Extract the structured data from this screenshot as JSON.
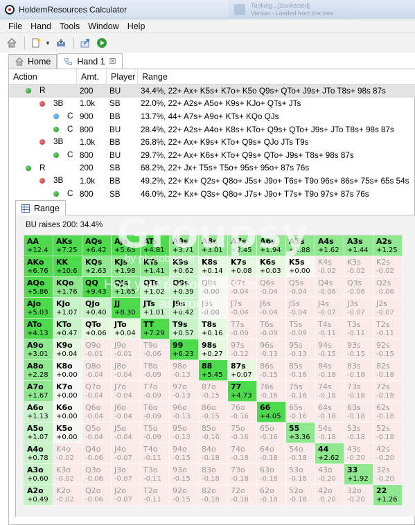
{
  "window": {
    "title": "HoldemResources Calculator"
  },
  "notification": {
    "line1": "Tanking...[Sunkissed]",
    "line2": "Versus - Loaded from the tree"
  },
  "menu": [
    "File",
    "Hand",
    "Tools",
    "Window",
    "Help"
  ],
  "toolbar": {
    "icons": [
      "home-icon",
      "new-document-icon",
      "open-icon",
      "export-icon",
      "run-icon"
    ]
  },
  "tabs": [
    {
      "label": "Home",
      "icon": "home-icon"
    },
    {
      "label": "Hand 1",
      "icon": "hand-icon",
      "closable": true
    }
  ],
  "table": {
    "headers": {
      "action": "Action",
      "amount": "Amt.",
      "player": "Player",
      "range": "Range"
    },
    "rows": [
      {
        "level": 0,
        "dot": "green",
        "action": "R",
        "amount": "200",
        "player": "BU",
        "range": "34.4%, 22+ Ax+ K5s+ K7o+ K5o Q9s+ QTo+ J9s+ JTo T8s+ 98s 87s",
        "selected": true
      },
      {
        "level": 1,
        "dot": "red",
        "action": "3B",
        "amount": "1.0k",
        "player": "SB",
        "range": "22.0%, 22+ A2s+ A5o+ K9s+ KJo+ QTs+ JTs"
      },
      {
        "level": 2,
        "dot": "blue",
        "action": "C",
        "amount": "900",
        "player": "BB",
        "range": "13.7%, 44+ A7s+ A9o+ KTs+ KQo QJs"
      },
      {
        "level": 2,
        "dot": "green",
        "action": "C",
        "amount": "800",
        "player": "BU",
        "range": "28.4%, 22+ A2s+ A4o+ K8s+ KTo+ Q9s+ QTo+ J9s+ JTo T8s+ 98s 87s"
      },
      {
        "level": 1,
        "dot": "red",
        "action": "3B",
        "amount": "1.0k",
        "player": "BB",
        "range": "26.8%, 22+ Ax+ K9s+ KTo+ Q9s+ QJo JTs T9s"
      },
      {
        "level": 2,
        "dot": "green",
        "action": "C",
        "amount": "800",
        "player": "BU",
        "range": "29.7%, 22+ Ax+ K6s+ KTo+ Q9s+ QTo+ J9s+ T8s+ 98s 87s"
      },
      {
        "level": 0,
        "dot": "green",
        "action": "R",
        "amount": "200",
        "player": "SB",
        "range": "68.2%, 22+ Jx+ T5s+ T5o+ 95s+ 95o+ 87s 76s"
      },
      {
        "level": 1,
        "dot": "red",
        "action": "3B",
        "amount": "1.0k",
        "player": "BB",
        "range": "49.2%, 22+ Kx+ Q2s+ Q8o+ J5s+ J9o+ T6s+ T9o 96s+ 86s+ 75s+ 65s 54s"
      },
      {
        "level": 2,
        "dot": "green",
        "action": "C",
        "amount": "800",
        "player": "SB",
        "range": "46.0%, 22+ Kx+ Q3s+ Q8o+ J7s+ J9o+ T7s+ T9o 97s+ 87s 76s"
      }
    ]
  },
  "range_panel": {
    "tab_label": "Range",
    "summary": "BU raises 200: 34.4%",
    "cells": [
      [
        "AA",
        "+12.4"
      ],
      [
        "AKs",
        "+7.25"
      ],
      [
        "AQs",
        "+6.42"
      ],
      [
        "AJs",
        "+5.65"
      ],
      [
        "ATs",
        "+4.81"
      ],
      [
        "A9s",
        "+3.71"
      ],
      [
        "A8s",
        "+3.01"
      ],
      [
        "A7s",
        "+2.45"
      ],
      [
        "A6s",
        "+1.94"
      ],
      [
        "A5s",
        "+1.88"
      ],
      [
        "A4s",
        "+1.62"
      ],
      [
        "A3s",
        "+1.44"
      ],
      [
        "A2s",
        "+1.25"
      ],
      [
        "AKo",
        "+6.76"
      ],
      [
        "KK",
        "+10.6"
      ],
      [
        "KQs",
        "+2.63"
      ],
      [
        "KJs",
        "+1.98"
      ],
      [
        "KTs",
        "+1.41"
      ],
      [
        "K9s",
        "+0.62"
      ],
      [
        "K8s",
        "+0.14"
      ],
      [
        "K7s",
        "+0.08"
      ],
      [
        "K6s",
        "+0.03"
      ],
      [
        "K5s",
        "+0.00"
      ],
      [
        "K4s",
        "-0.02"
      ],
      [
        "K3s",
        "-0.02"
      ],
      [
        "K2s",
        "-0.02"
      ],
      [
        "AQo",
        "+5.86"
      ],
      [
        "KQo",
        "+1.76"
      ],
      [
        "QQ",
        "+9.43"
      ],
      [
        "QJs",
        "+1.65"
      ],
      [
        "QTs",
        "+1.02"
      ],
      [
        "Q9s",
        "+0.39"
      ],
      [
        "Q8s",
        "-0.00"
      ],
      [
        "Q7s",
        "-0.04"
      ],
      [
        "Q6s",
        "-0.04"
      ],
      [
        "Q5s",
        "-0.04"
      ],
      [
        "Q4s",
        "-0.06"
      ],
      [
        "Q3s",
        "-0.06"
      ],
      [
        "Q2s",
        "-0.06"
      ],
      [
        "AJo",
        "+5.03"
      ],
      [
        "KJo",
        "+1.07"
      ],
      [
        "QJo",
        "+0.40"
      ],
      [
        "JJ",
        "+8.30"
      ],
      [
        "JTs",
        "+1.01"
      ],
      [
        "J9s",
        "+0.42"
      ],
      [
        "J8s",
        "-0.00"
      ],
      [
        "J7s",
        "-0.04"
      ],
      [
        "J6s",
        "-0.04"
      ],
      [
        "J5s",
        "-0.04"
      ],
      [
        "J4s",
        "-0.07"
      ],
      [
        "J3s",
        "-0.07"
      ],
      [
        "J2s",
        "-0.07"
      ],
      [
        "ATo",
        "+4.13"
      ],
      [
        "KTo",
        "+0.47"
      ],
      [
        "QTo",
        "+0.06"
      ],
      [
        "JTo",
        "+0.04"
      ],
      [
        "TT",
        "+7.29"
      ],
      [
        "T9s",
        "+0.57"
      ],
      [
        "T8s",
        "+0.16"
      ],
      [
        "T7s",
        "-0.09"
      ],
      [
        "T6s",
        "-0.09"
      ],
      [
        "T5s",
        "-0.09"
      ],
      [
        "T4s",
        "-0.11"
      ],
      [
        "T3s",
        "-0.11"
      ],
      [
        "T2s",
        "-0.11"
      ],
      [
        "A9o",
        "+3.01"
      ],
      [
        "K9o",
        "+0.04"
      ],
      [
        "Q9o",
        "-0.01"
      ],
      [
        "J9o",
        "-0.01"
      ],
      [
        "T9o",
        "-0.06"
      ],
      [
        "99",
        "+6.23"
      ],
      [
        "98s",
        "+0.27"
      ],
      [
        "97s",
        "-0.12"
      ],
      [
        "96s",
        "-0.13"
      ],
      [
        "95s",
        "-0.13"
      ],
      [
        "94s",
        "-0.15"
      ],
      [
        "93s",
        "-0.15"
      ],
      [
        "92s",
        "-0.15"
      ],
      [
        "A8o",
        "+2.28"
      ],
      [
        "K8o",
        "+0.00"
      ],
      [
        "Q8o",
        "-0.04"
      ],
      [
        "J8o",
        "-0.04"
      ],
      [
        "T8o",
        "-0.09"
      ],
      [
        "98o",
        "-0.13"
      ],
      [
        "88",
        "+5.45"
      ],
      [
        "87s",
        "+0.07"
      ],
      [
        "86s",
        "-0.15"
      ],
      [
        "85s",
        "-0.16"
      ],
      [
        "84s",
        "-0.18"
      ],
      [
        "83s",
        "-0.18"
      ],
      [
        "82s",
        "-0.18"
      ],
      [
        "A7o",
        "+1.67"
      ],
      [
        "K7o",
        "+0.00"
      ],
      [
        "Q7o",
        "-0.04"
      ],
      [
        "J7o",
        "-0.04"
      ],
      [
        "T7o",
        "-0.09"
      ],
      [
        "97o",
        "-0.13"
      ],
      [
        "87o",
        "-0.15"
      ],
      [
        "77",
        "+4.73"
      ],
      [
        "76s",
        "-0.16"
      ],
      [
        "75s",
        "-0.16"
      ],
      [
        "74s",
        "-0.18"
      ],
      [
        "73s",
        "-0.18"
      ],
      [
        "72s",
        "-0.18"
      ],
      [
        "A6o",
        "+1.13"
      ],
      [
        "K6o",
        "+0.00"
      ],
      [
        "Q6o",
        "-0.04"
      ],
      [
        "J6o",
        "-0.04"
      ],
      [
        "T6o",
        "-0.09"
      ],
      [
        "96o",
        "-0.13"
      ],
      [
        "86o",
        "-0.15"
      ],
      [
        "76o",
        "-0.16"
      ],
      [
        "66",
        "+4.05"
      ],
      [
        "65s",
        "-0.16"
      ],
      [
        "64s",
        "-0.18"
      ],
      [
        "63s",
        "-0.18"
      ],
      [
        "62s",
        "-0.18"
      ],
      [
        "A5o",
        "+1.07"
      ],
      [
        "K5o",
        "+0.00"
      ],
      [
        "Q5o",
        "-0.04"
      ],
      [
        "J5o",
        "-0.04"
      ],
      [
        "T5o",
        "-0.09"
      ],
      [
        "95o",
        "-0.13"
      ],
      [
        "85o",
        "-0.16"
      ],
      [
        "75o",
        "-0.16"
      ],
      [
        "65o",
        "-0.16"
      ],
      [
        "55",
        "+3.36"
      ],
      [
        "54s",
        "-0.18"
      ],
      [
        "53s",
        "-0.18"
      ],
      [
        "52s",
        "-0.18"
      ],
      [
        "A4o",
        "+0.78"
      ],
      [
        "K4o",
        "-0.02"
      ],
      [
        "Q4o",
        "-0.06"
      ],
      [
        "J4o",
        "-0.07"
      ],
      [
        "T4o",
        "-0.11"
      ],
      [
        "94o",
        "-0.15"
      ],
      [
        "84o",
        "-0.18"
      ],
      [
        "74o",
        "-0.18"
      ],
      [
        "64o",
        "-0.18"
      ],
      [
        "54o",
        "-0.18"
      ],
      [
        "44",
        "+2.62"
      ],
      [
        "43s",
        "-0.20"
      ],
      [
        "42s",
        "-0.20"
      ],
      [
        "A3o",
        "+0.60"
      ],
      [
        "K3o",
        "-0.02"
      ],
      [
        "Q3o",
        "-0.06"
      ],
      [
        "J3o",
        "-0.07"
      ],
      [
        "T3o",
        "-0.11"
      ],
      [
        "93o",
        "-0.15"
      ],
      [
        "83o",
        "-0.18"
      ],
      [
        "73o",
        "-0.18"
      ],
      [
        "63o",
        "-0.18"
      ],
      [
        "53o",
        "-0.18"
      ],
      [
        "43o",
        "-0.20"
      ],
      [
        "33",
        "+1.92"
      ],
      [
        "32s",
        "-0.20"
      ],
      [
        "A2o",
        "+0.49"
      ],
      [
        "K2o",
        "-0.02"
      ],
      [
        "Q2o",
        "-0.06"
      ],
      [
        "J2o",
        "-0.07"
      ],
      [
        "T2o",
        "-0.11"
      ],
      [
        "92o",
        "-0.15"
      ],
      [
        "82o",
        "-0.18"
      ],
      [
        "72o",
        "-0.18"
      ],
      [
        "62o",
        "-0.18"
      ],
      [
        "52o",
        "-0.18"
      ],
      [
        "42o",
        "-0.20"
      ],
      [
        "32o",
        "-0.20"
      ],
      [
        "22",
        "+1.26"
      ]
    ]
  },
  "colors": {
    "strong": "#4ddb4d",
    "medium": "#8fe88f",
    "light": "#c8f3c8",
    "faint": "#e6f8e0",
    "negative": "#fbeaea",
    "neutral": "#f7f7f3"
  },
  "watermark": {
    "main": "Groupsy",
    "line1": "by photobucket",
    "line2": "Host your photos & videos",
    "line3": "as groups"
  }
}
